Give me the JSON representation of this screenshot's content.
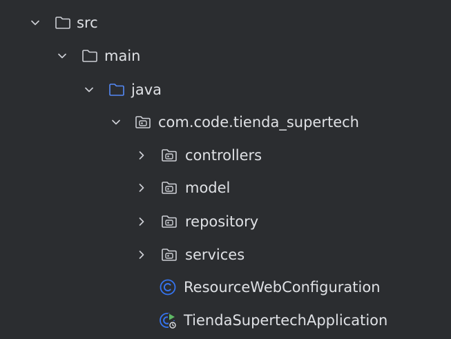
{
  "colors": {
    "background": "#2b2d30",
    "text": "#dfe1e5",
    "icon_gray": "#ced0d6",
    "java_folder_blue": "#548af7",
    "class_blue": "#3574f0",
    "run_green": "#5fb865"
  },
  "tree": {
    "nodes": [
      {
        "label": "src",
        "icon": "folder-icon",
        "expanded": true
      },
      {
        "label": "main",
        "icon": "folder-icon",
        "expanded": true
      },
      {
        "label": "java",
        "icon": "source-root-folder-icon",
        "expanded": true
      },
      {
        "label": "com.code.tienda_supertech",
        "icon": "package-icon",
        "expanded": true
      },
      {
        "label": "controllers",
        "icon": "package-icon",
        "expanded": false
      },
      {
        "label": "model",
        "icon": "package-icon",
        "expanded": false
      },
      {
        "label": "repository",
        "icon": "package-icon",
        "expanded": false
      },
      {
        "label": "services",
        "icon": "package-icon",
        "expanded": false
      },
      {
        "label": "ResourceWebConfiguration",
        "icon": "class-icon"
      },
      {
        "label": "TiendaSupertechApplication",
        "icon": "runnable-class-icon"
      }
    ]
  }
}
